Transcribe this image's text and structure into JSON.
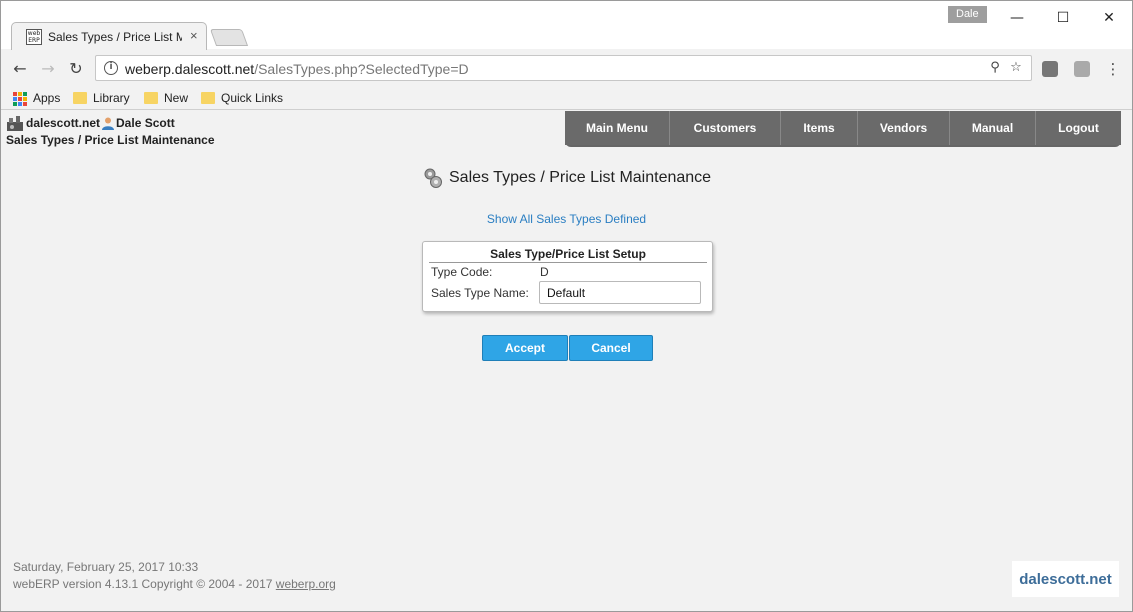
{
  "browser": {
    "tab_title": "Sales Types / Price List M",
    "tab_favicon_text": "web ERP",
    "tab_close": "×",
    "profile_name": "Dale",
    "window_min": "—",
    "window_max": "☐",
    "window_close": "✕",
    "url_host": "weberp.dalescott.net",
    "url_path": "/SalesTypes.php?SelectedType=D",
    "bookmarks": [
      {
        "label": "Apps"
      },
      {
        "label": "Library"
      },
      {
        "label": "New"
      },
      {
        "label": "Quick Links"
      }
    ],
    "apps_colors": [
      "#e8453c",
      "#f4b400",
      "#0f9d58",
      "#4285f4",
      "#e8453c",
      "#f4b400",
      "#0f9d58",
      "#4285f4",
      "#e8453c"
    ],
    "icons": {
      "back": "←",
      "forward": "→",
      "reload": "↻",
      "zoom": "⚲",
      "star": "☆",
      "menu": "⋮",
      "info": "i"
    }
  },
  "header": {
    "company": "dalescott.net",
    "user": "Dale Scott",
    "breadcrumb": "Sales Types / Price List Maintenance"
  },
  "nav": {
    "items": [
      {
        "label": "Main Menu"
      },
      {
        "label": "Customers"
      },
      {
        "label": "Items"
      },
      {
        "label": "Vendors"
      },
      {
        "label": "Manual"
      },
      {
        "label": "Logout"
      }
    ]
  },
  "main": {
    "title": "Sales Types / Price List Maintenance",
    "show_all_link": "Show All Sales Types Defined",
    "setup": {
      "heading": "Sales Type/Price List Setup",
      "type_code_label": "Type Code:",
      "type_code_value": "D",
      "name_label": "Sales Type Name:",
      "name_value": "Default"
    },
    "accept_label": "Accept",
    "cancel_label": "Cancel"
  },
  "footer": {
    "datetime": "Saturday, February 25, 2017 10:33",
    "version_text": "webERP version 4.13.1 Copyright © 2004 - 2017",
    "link_text": "weberp.org",
    "logo_text": "dalescott.net"
  },
  "colors": {
    "accent_button": "#2fa5e6",
    "nav_bg": "#666666",
    "link": "#2a7ec2"
  }
}
